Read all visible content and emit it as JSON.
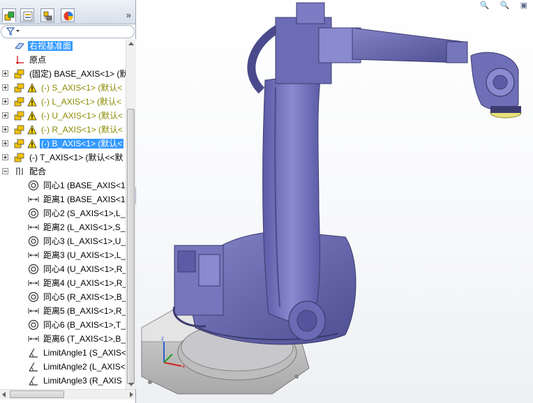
{
  "panel": {
    "tabs": [
      {
        "name": "feature-manager"
      },
      {
        "name": "property-manager"
      },
      {
        "name": "configuration-manager"
      },
      {
        "name": "display-manager"
      }
    ],
    "more_label": "»"
  },
  "tree": [
    {
      "label": "右视基准面",
      "icon": "plane-icon",
      "style": "sel",
      "expander": "none",
      "indent": 20
    },
    {
      "label": "原点",
      "icon": "origin-icon",
      "style": "",
      "expander": "none",
      "indent": 20
    },
    {
      "label": "(固定) BASE_AXIS<1> (默",
      "icon": "part-icon",
      "style": "",
      "expander": "plus",
      "warn": false,
      "indent": 20
    },
    {
      "label": "(-) S_AXIS<1> (默认<",
      "icon": "part-icon",
      "style": "warn",
      "expander": "plus",
      "warn": true,
      "indent": 20
    },
    {
      "label": "(-) L_AXIS<1> (默认<",
      "icon": "part-icon",
      "style": "warn",
      "expander": "plus",
      "warn": true,
      "indent": 20
    },
    {
      "label": "(-) U_AXIS<1> (默认<",
      "icon": "part-icon",
      "style": "warn",
      "expander": "plus",
      "warn": true,
      "indent": 20
    },
    {
      "label": "(-) R_AXIS<1> (默认<",
      "icon": "part-icon",
      "style": "warn",
      "expander": "plus",
      "warn": true,
      "indent": 20
    },
    {
      "label": "(-) B_AXIS<1> (默认<",
      "icon": "part-icon",
      "style": "sel-warn",
      "expander": "plus",
      "warn": true,
      "indent": 20
    },
    {
      "label": "(-) T_AXIS<1> (默认<<默",
      "icon": "part-icon",
      "style": "",
      "expander": "plus",
      "warn": false,
      "indent": 20
    },
    {
      "label": "配合",
      "icon": "mates-icon",
      "style": "",
      "expander": "minus",
      "warn": false,
      "indent": 20
    },
    {
      "label": "同心1 (BASE_AXIS<1",
      "icon": "concentric-icon",
      "style": "",
      "expander": "none",
      "indent": 40
    },
    {
      "label": "距离1 (BASE_AXIS<1",
      "icon": "distance-icon",
      "style": "",
      "expander": "none",
      "indent": 40
    },
    {
      "label": "同心2 (S_AXIS<1>,L_",
      "icon": "concentric-icon",
      "style": "",
      "expander": "none",
      "indent": 40
    },
    {
      "label": "距离2 (L_AXIS<1>,S_",
      "icon": "distance-icon",
      "style": "",
      "expander": "none",
      "indent": 40
    },
    {
      "label": "同心3 (L_AXIS<1>,U_",
      "icon": "concentric-icon",
      "style": "",
      "expander": "none",
      "indent": 40
    },
    {
      "label": "距离3 (U_AXIS<1>,L_",
      "icon": "distance-icon",
      "style": "",
      "expander": "none",
      "indent": 40
    },
    {
      "label": "同心4 (U_AXIS<1>,R_",
      "icon": "concentric-icon",
      "style": "",
      "expander": "none",
      "indent": 40
    },
    {
      "label": "距离4 (U_AXIS<1>,R_",
      "icon": "distance-icon",
      "style": "",
      "expander": "none",
      "indent": 40
    },
    {
      "label": "同心5 (R_AXIS<1>,B_",
      "icon": "concentric-icon",
      "style": "",
      "expander": "none",
      "indent": 40
    },
    {
      "label": "距离5 (B_AXIS<1>,R_",
      "icon": "distance-icon",
      "style": "",
      "expander": "none",
      "indent": 40
    },
    {
      "label": "同心6 (B_AXIS<1>,T_",
      "icon": "concentric-icon",
      "style": "",
      "expander": "none",
      "indent": 40
    },
    {
      "label": "距离6 (T_AXIS<1>,B_",
      "icon": "distance-icon",
      "style": "",
      "expander": "none",
      "indent": 40
    },
    {
      "label": "LimitAngle1 (S_AXIS<",
      "icon": "angle-icon",
      "style": "",
      "expander": "none",
      "indent": 40
    },
    {
      "label": "LimitAngle2 (L_AXIS<",
      "icon": "angle-icon",
      "style": "",
      "expander": "none",
      "indent": 40
    },
    {
      "label": "LimitAngle3 (R_AXIS",
      "icon": "angle-icon",
      "style": "",
      "expander": "none",
      "indent": 40
    }
  ],
  "colors": {
    "robot_body": "#6f6fb8",
    "robot_shade": "#4a4a8c",
    "base_grey": "#c8c8c8",
    "flange_yellow": "#e8e07a",
    "selection": "#3399ff",
    "warning": "#e8c000"
  }
}
